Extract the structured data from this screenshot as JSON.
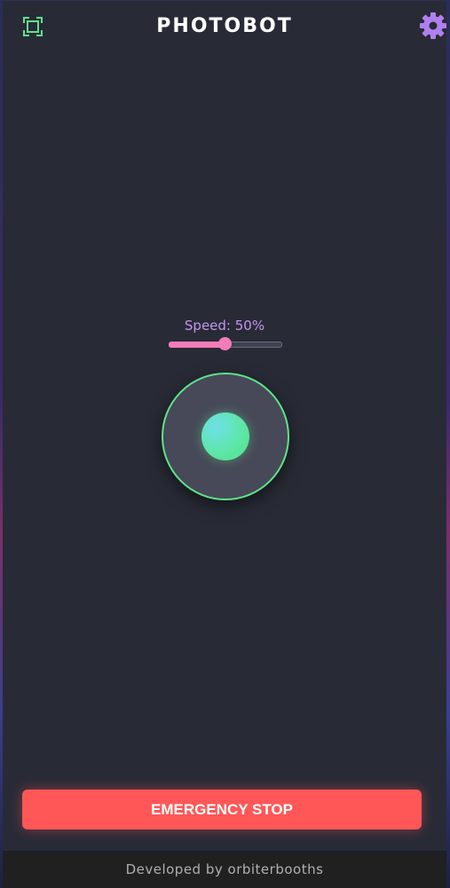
{
  "header": {
    "title": "PHOTOBOT",
    "fullscreen_icon": "fullscreen-icon",
    "settings_icon": "gear-icon"
  },
  "controls": {
    "speed_label": "Speed: 50%",
    "speed_percent": 50
  },
  "joystick": {
    "x": 0,
    "y": 0
  },
  "actions": {
    "emergency_stop_label": "EMERGENCY STOP"
  },
  "footer": {
    "text": "Developed by orbiterbooths"
  },
  "colors": {
    "accent_green": "#5ee38a",
    "accent_purple": "#b07ff0",
    "slider_pink": "#f27cb8",
    "stop_red": "#ff5757",
    "panel_bg": "#282b36"
  }
}
